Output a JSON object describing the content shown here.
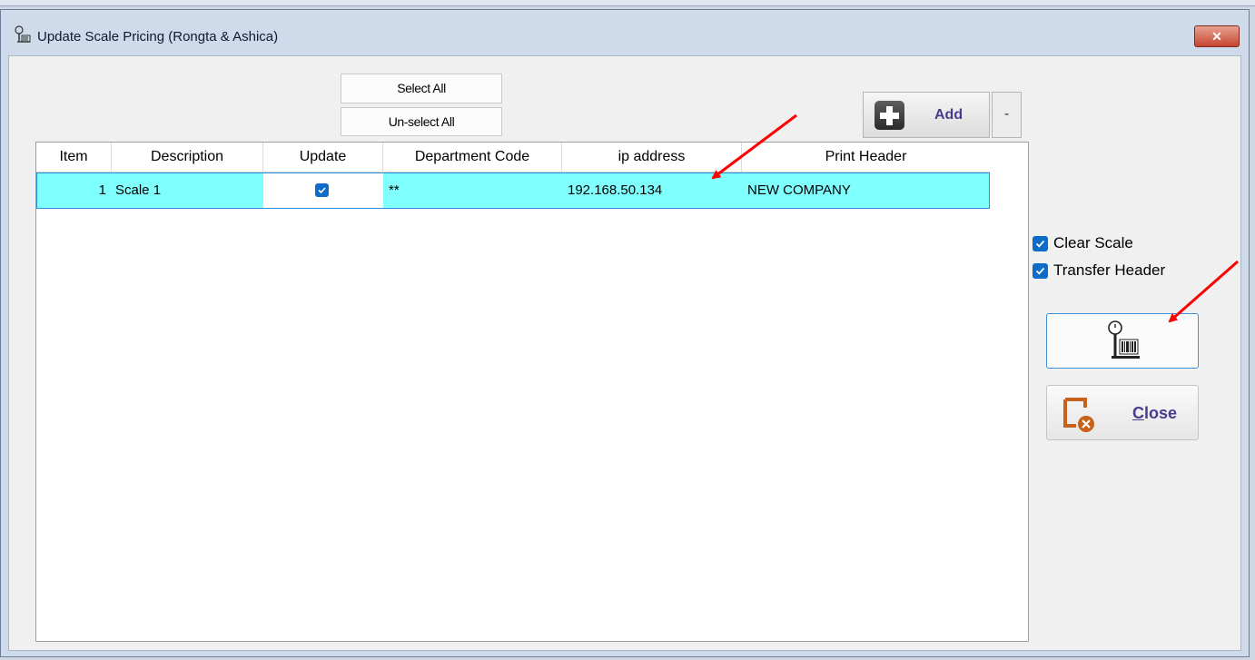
{
  "window": {
    "title": "Update Scale Pricing (Rongta & Ashica)",
    "close_glyph": "✕"
  },
  "toolbar": {
    "select_all": "Select All",
    "unselect_all": "Un-select All",
    "add_label": "Add",
    "minus_label": "-"
  },
  "grid": {
    "columns": [
      "Item",
      "Description",
      "Update",
      "Department Code",
      "ip address",
      "Print Header"
    ],
    "rows": [
      {
        "item": "1",
        "description": "Scale 1",
        "update": true,
        "department_code": "**",
        "ip_address": "192.168.50.134",
        "print_header": "NEW COMPANY"
      }
    ]
  },
  "options": {
    "clear_scale": {
      "label": "Clear Scale",
      "checked": true
    },
    "transfer_header": {
      "label": "Transfer Header",
      "checked": true
    }
  },
  "buttons": {
    "scale_button_icon": "scale-barcode-icon",
    "close_first": "C",
    "close_rest": "lose",
    "close_icon": "close-window-icon"
  },
  "colors": {
    "row_highlight": "#80ffff",
    "checkbox_blue": "#0d6cc8",
    "button_text_purple": "#4a3c8c",
    "annotation_arrow": "#ff0000"
  }
}
